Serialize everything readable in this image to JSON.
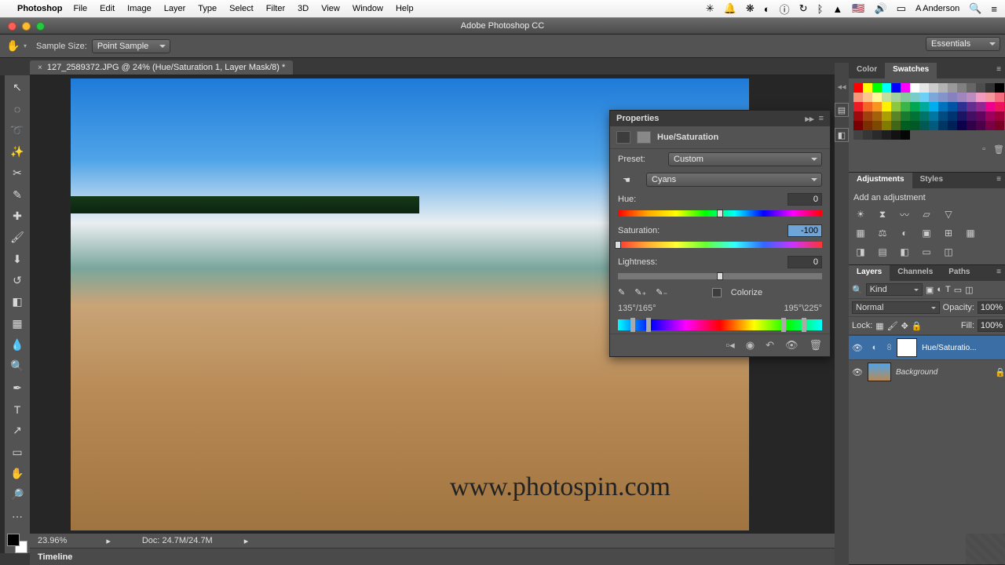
{
  "mac": {
    "app": "Photoshop",
    "menus": [
      "File",
      "Edit",
      "Image",
      "Layer",
      "Type",
      "Select",
      "Filter",
      "3D",
      "View",
      "Window",
      "Help"
    ],
    "right": {
      "user": "A Anderson",
      "flag": "🇺🇸"
    }
  },
  "window": {
    "title": "Adobe Photoshop CC"
  },
  "options": {
    "sample_label": "Sample Size:",
    "sample_value": "Point Sample",
    "workspace": "Essentials"
  },
  "doc": {
    "tab": "127_2589372.JPG @ 24% (Hue/Saturation 1, Layer Mask/8) *",
    "zoom": "23.96%",
    "docsize": "Doc: 24.7M/24.7M",
    "watermark": "www.photospin.com"
  },
  "timeline_label": "Timeline",
  "props": {
    "title": "Properties",
    "adj_name": "Hue/Saturation",
    "preset_label": "Preset:",
    "preset_value": "Custom",
    "channel": "Cyans",
    "hue_label": "Hue:",
    "hue_value": "0",
    "sat_label": "Saturation:",
    "sat_value": "-100",
    "light_label": "Lightness:",
    "light_value": "0",
    "colorize": "Colorize",
    "range_left": "135°/165°",
    "range_right": "195°\\225°"
  },
  "panels": {
    "color_tab": "Color",
    "swatches_tab": "Swatches",
    "adjustments_tab": "Adjustments",
    "styles_tab": "Styles",
    "add_adj": "Add an adjustment",
    "layers_tab": "Layers",
    "channels_tab": "Channels",
    "paths_tab": "Paths",
    "kind": "Kind",
    "blend": "Normal",
    "opacity_label": "Opacity:",
    "opacity": "100%",
    "lock_label": "Lock:",
    "fill_label": "Fill:",
    "fill": "100%",
    "layer1": "Hue/Saturatio...",
    "layer2": "Background"
  },
  "swatch_colors": [
    "ff0000",
    "ffff00",
    "00ff00",
    "00ffff",
    "0000ff",
    "ff00ff",
    "ffffff",
    "e6e6e6",
    "cccccc",
    "b3b3b3",
    "999999",
    "808080",
    "666666",
    "4d4d4d",
    "333333",
    "000000",
    "f7977a",
    "fdc68c",
    "fff79a",
    "c4df9b",
    "a3d39c",
    "82ca9c",
    "7accc8",
    "6dcff6",
    "7da7d9",
    "8493ca",
    "8781bd",
    "a186be",
    "bc8cbf",
    "f49ac0",
    "f5989d",
    "f26d7d",
    "ed1c24",
    "f26522",
    "f7941d",
    "fff200",
    "8dc73f",
    "39b54a",
    "00a651",
    "00a99d",
    "00aeef",
    "0072bc",
    "0054a6",
    "2e3192",
    "662d91",
    "92278f",
    "ec008c",
    "ed145b",
    "9e0b0f",
    "a0410d",
    "a36209",
    "aba000",
    "598527",
    "197b30",
    "007236",
    "00746b",
    "0076a3",
    "004b80",
    "003471",
    "1b1464",
    "440e62",
    "630460",
    "9e005d",
    "9e0039",
    "790000",
    "7b2e00",
    "7d4900",
    "827b00",
    "406618",
    "005e20",
    "005826",
    "005952",
    "005b7f",
    "003663",
    "002157",
    "0d004c",
    "32004b",
    "4b0049",
    "7b0046",
    "7b0026",
    "424242",
    "363636",
    "2a2a2a",
    "1e1e1e",
    "121212",
    "060606"
  ]
}
